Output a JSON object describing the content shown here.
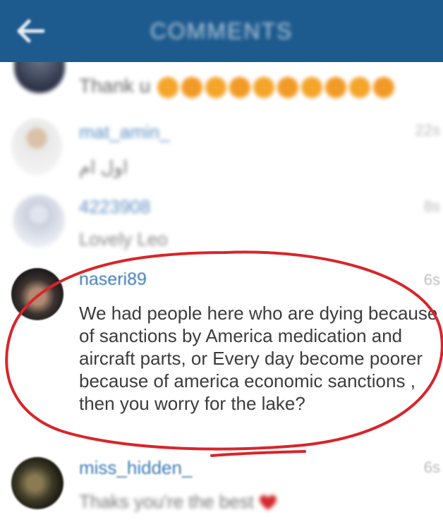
{
  "header": {
    "title": "COMMENTS",
    "back_icon": "back-arrow-icon",
    "background": "#1d5a8d"
  },
  "comments": [
    {
      "username": "",
      "time": "",
      "text": "Thank u"
    },
    {
      "username": "mat_amin_",
      "time": "22s",
      "text": "اول ام"
    },
    {
      "username": "4223908",
      "time": "8s",
      "text": "Lovely Leo"
    },
    {
      "username": "naseri89",
      "time": "6s",
      "text": "We had people here who are dying because of sanctions by America medication and aircraft parts, or Every day become poorer because of america economic sanctions , then you worry for the lake?"
    },
    {
      "username": "miss_hidden_",
      "time": "6s",
      "text": "Thaks you're the best"
    }
  ],
  "annotation_color": "#d8252a",
  "link_color": "#3d7bb8"
}
